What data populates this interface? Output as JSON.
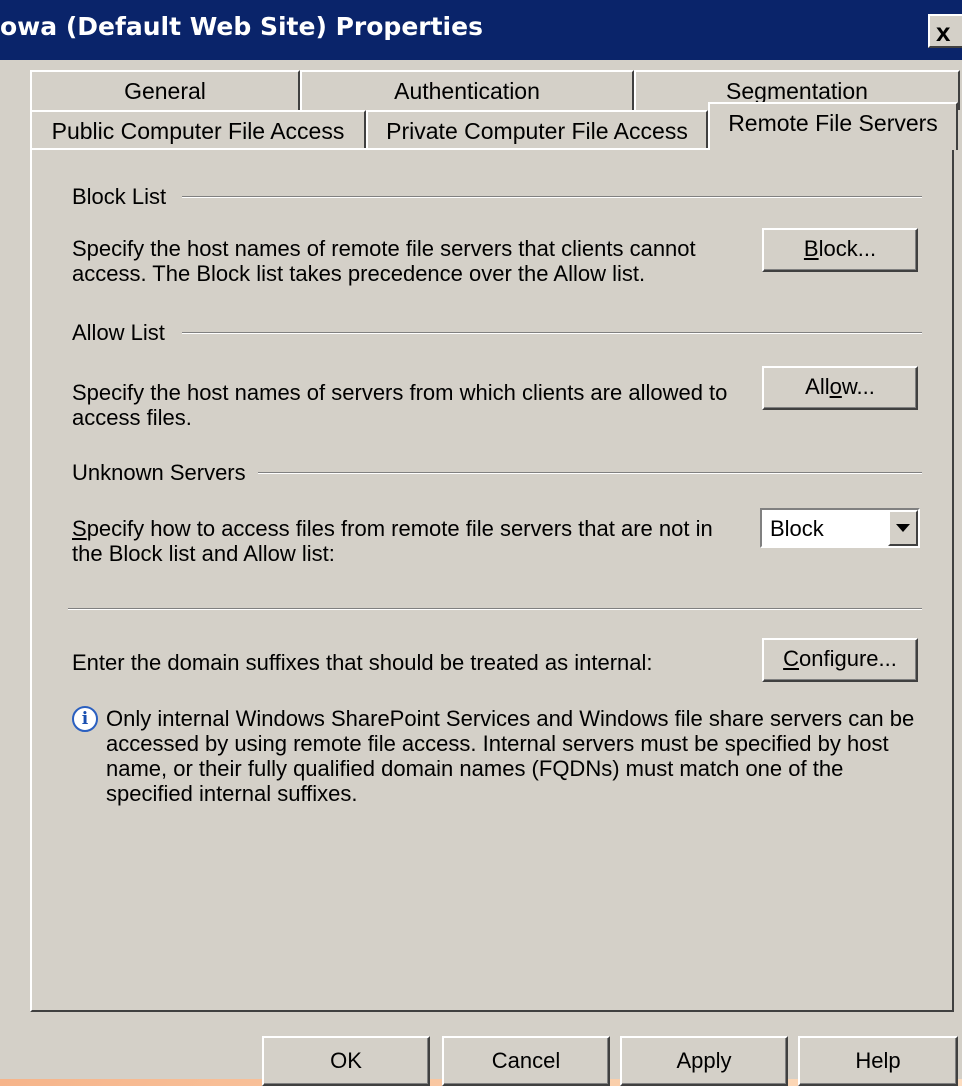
{
  "window": {
    "title": "owa (Default Web Site) Properties",
    "close_label": "x"
  },
  "tabs": {
    "row1": [
      {
        "label": "General"
      },
      {
        "label": "Authentication"
      },
      {
        "label": "Segmentation"
      }
    ],
    "row2": [
      {
        "label": "Public Computer File Access"
      },
      {
        "label": "Private Computer File Access"
      },
      {
        "label": "Remote File Servers",
        "active": true
      }
    ]
  },
  "block_list": {
    "heading": "Block List",
    "description": "Specify the host names of remote file servers that clients cannot access. The Block list takes precedence over the Allow list.",
    "button_mnemonic": "B",
    "button_rest": "lock..."
  },
  "allow_list": {
    "heading": "Allow List",
    "description": "Specify the host names of servers from which clients are allowed to access files.",
    "button_pre": "All",
    "button_mnemonic": "o",
    "button_rest": "w..."
  },
  "unknown_servers": {
    "heading": "Unknown Servers",
    "desc_mnemonic": "S",
    "desc_rest": "pecify how to access files from remote file servers that are not in the Block list and Allow list:",
    "selected_option": "Block"
  },
  "internal": {
    "prompt": "Enter the domain suffixes that should be treated as internal:",
    "button_mnemonic": "C",
    "button_rest": "onfigure...",
    "info_text": "Only internal Windows SharePoint Services and Windows file share servers can be accessed by using remote file access. Internal servers must be specified by host name, or their fully qualified domain names (FQDNs) must match one of the specified internal suffixes."
  },
  "footer": {
    "ok": "OK",
    "cancel": "Cancel",
    "apply": "Apply",
    "help": "Help"
  },
  "colors": {
    "titlebar": "#0a246a",
    "face": "#d4d0c8"
  }
}
